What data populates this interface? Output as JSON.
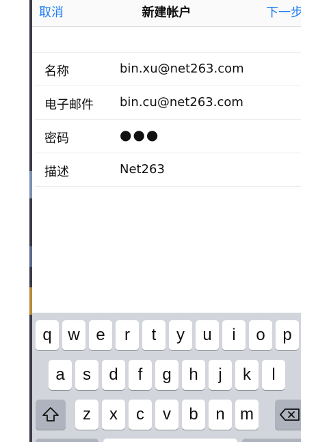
{
  "nav": {
    "cancel": "取消",
    "title": "新建帐户",
    "next": "下一步"
  },
  "form": {
    "rows": [
      {
        "label": "名称",
        "value": "bin.xu@net263.com"
      },
      {
        "label": "电子邮件",
        "value": "bin.cu@net263.com"
      },
      {
        "label": "密码",
        "value": "●●●"
      },
      {
        "label": "描述",
        "value": "Net263"
      }
    ]
  },
  "keyboard": {
    "row1": [
      "q",
      "w",
      "e",
      "r",
      "t",
      "y",
      "u",
      "i",
      "o",
      "p"
    ],
    "row2": [
      "a",
      "s",
      "d",
      "f",
      "g",
      "h",
      "j",
      "k",
      "l"
    ],
    "row3": [
      "z",
      "x",
      "c",
      "v",
      "b",
      "n",
      "m"
    ],
    "shift_icon": "shift-icon",
    "delete_icon": "delete-icon"
  }
}
